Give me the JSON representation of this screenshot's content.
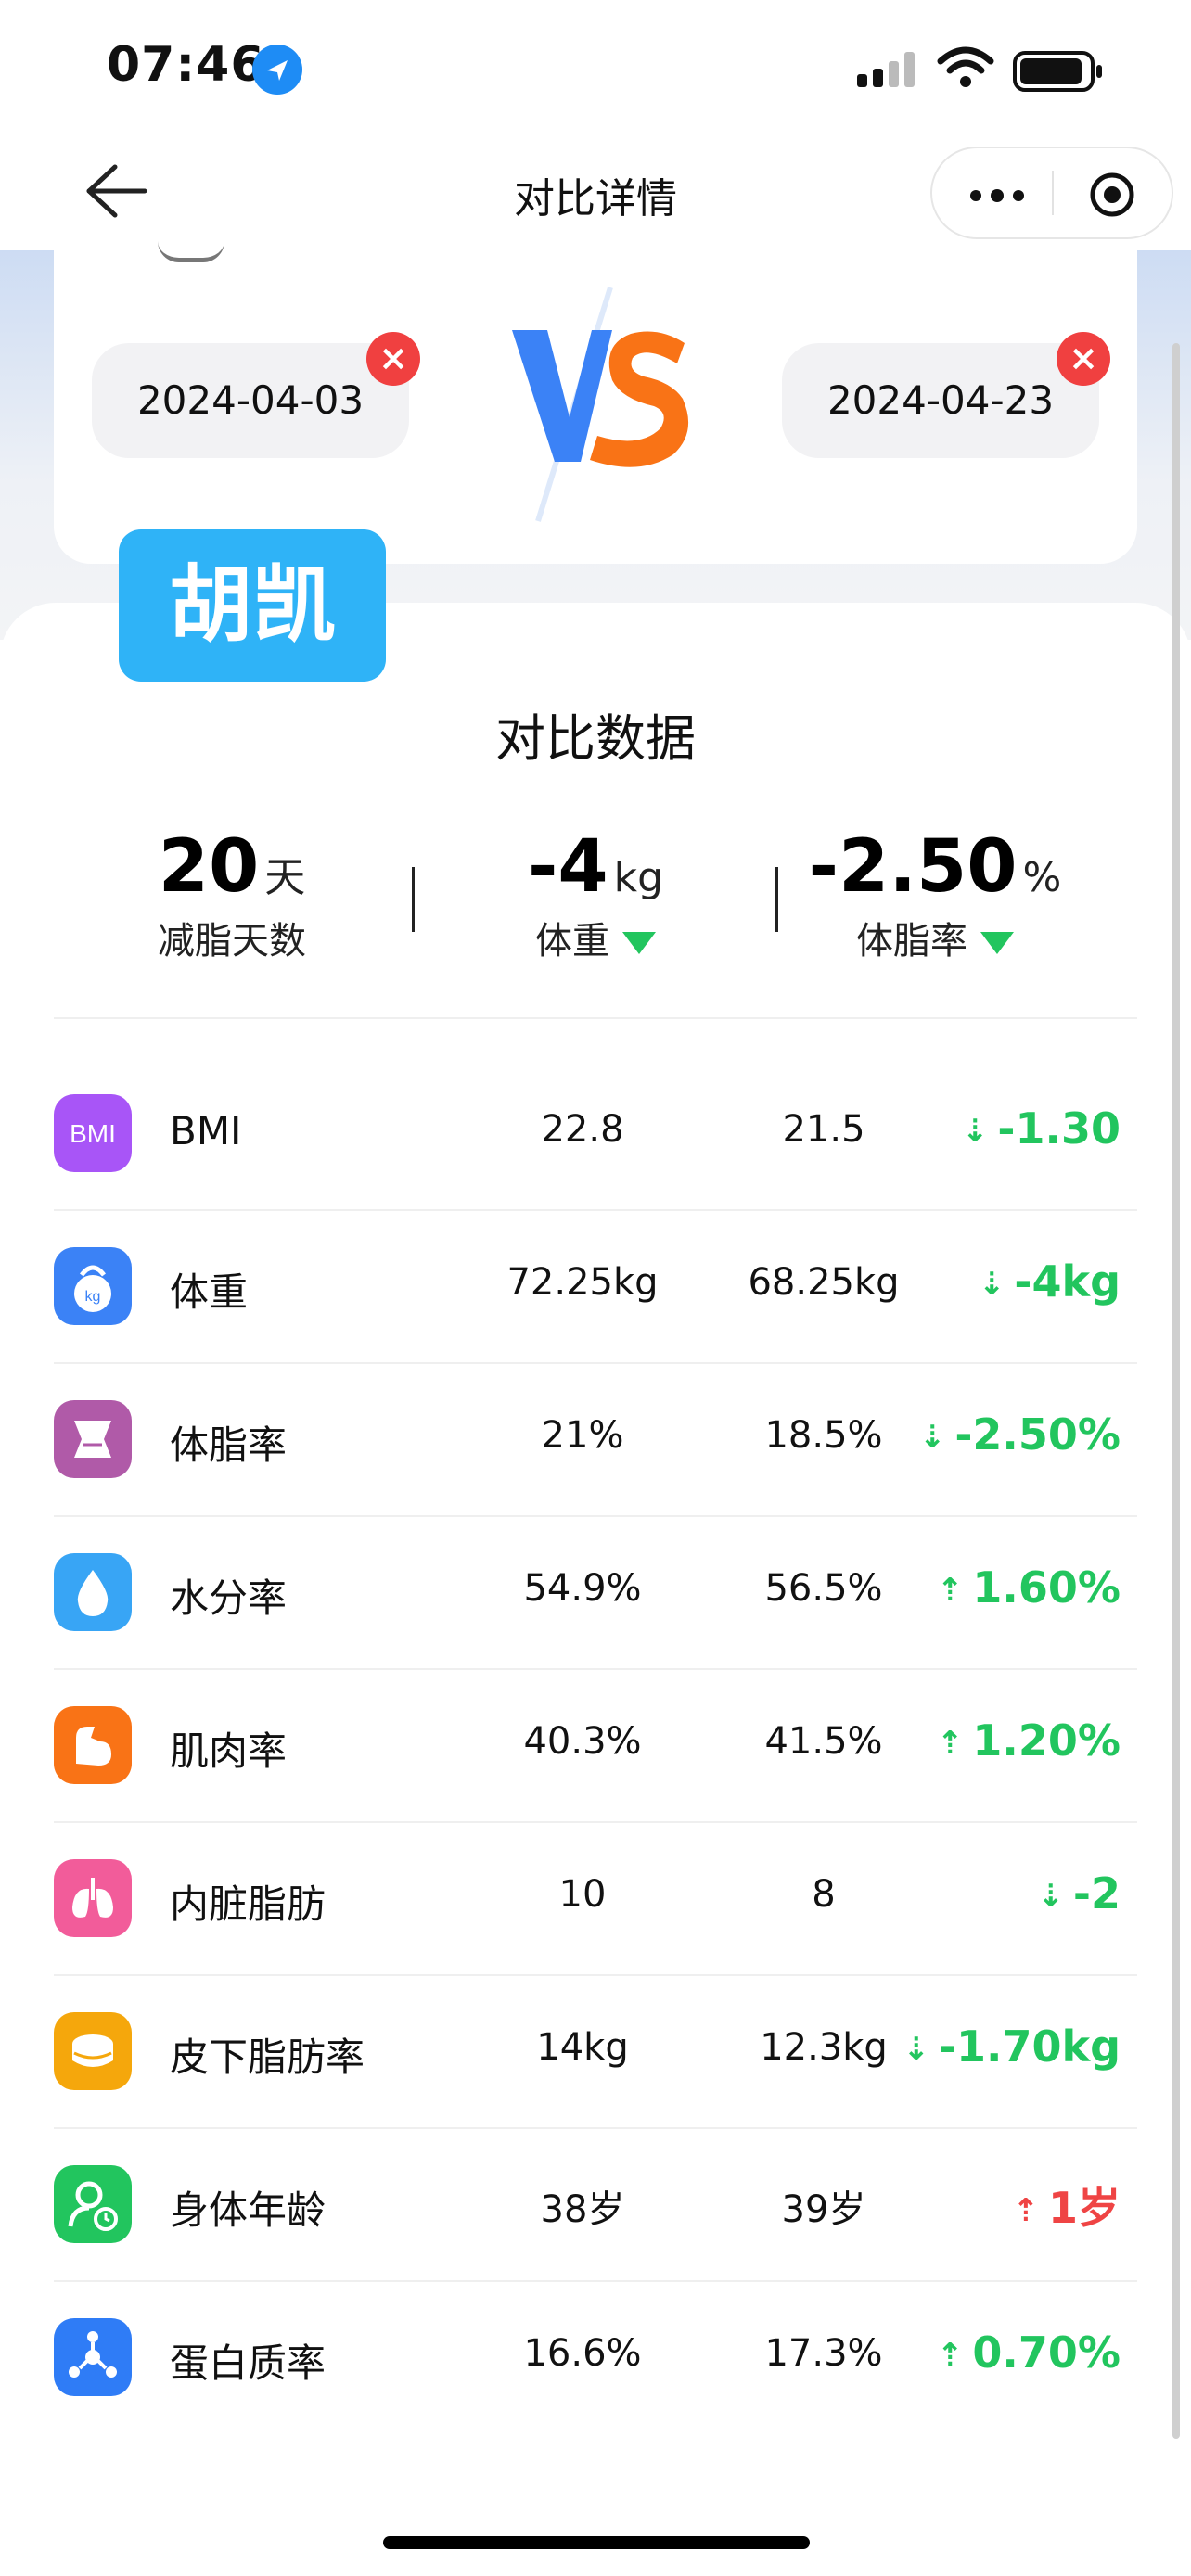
{
  "status_bar": {
    "time": "07:46"
  },
  "nav": {
    "title": "对比详情"
  },
  "compare": {
    "date_left": "2024-04-03",
    "date_right": "2024-04-23",
    "vs": "VS",
    "name": "胡凯"
  },
  "section_title": "对比数据",
  "summary": [
    {
      "value": "20",
      "unit": "天",
      "label": "减脂天数",
      "trend": ""
    },
    {
      "value": "-4",
      "unit": "kg",
      "label": "体重",
      "trend": "down"
    },
    {
      "value": "-2.50",
      "unit": "%",
      "label": "体脂率",
      "trend": "down"
    }
  ],
  "rows": [
    {
      "name": "BMI",
      "v1": "22.8",
      "v2": "21.5",
      "diff": "-1.30",
      "trend": "down",
      "icon": "bmi-icon",
      "color": "#a855f7"
    },
    {
      "name": "体重",
      "v1": "72.25kg",
      "v2": "68.25kg",
      "diff": "-4kg",
      "trend": "down",
      "icon": "kettlebell-icon",
      "color": "#3b82f6"
    },
    {
      "name": "体脂率",
      "v1": "21%",
      "v2": "18.5%",
      "diff": "-2.50%",
      "trend": "down",
      "icon": "body-fat-icon",
      "color": "#b05aa8"
    },
    {
      "name": "水分率",
      "v1": "54.9%",
      "v2": "56.5%",
      "diff": "1.60%",
      "trend": "up",
      "icon": "water-drop-icon",
      "color": "#38a5f5"
    },
    {
      "name": "肌肉率",
      "v1": "40.3%",
      "v2": "41.5%",
      "diff": "1.20%",
      "trend": "up",
      "icon": "muscle-icon",
      "color": "#f97316"
    },
    {
      "name": "内脏脂肪",
      "v1": "10",
      "v2": "8",
      "diff": "-2",
      "trend": "down",
      "icon": "lungs-icon",
      "color": "#f25c9a"
    },
    {
      "name": "皮下脂肪率",
      "v1": "14kg",
      "v2": "12.3kg",
      "diff": "-1.70kg",
      "trend": "down",
      "icon": "fat-layer-icon",
      "color": "#f5a70c"
    },
    {
      "name": "身体年龄",
      "v1": "38岁",
      "v2": "39岁",
      "diff": "1岁",
      "trend": "up-bad",
      "icon": "body-age-icon",
      "color": "#22c55e"
    },
    {
      "name": "蛋白质率",
      "v1": "16.6%",
      "v2": "17.3%",
      "diff": "0.70%",
      "trend": "up",
      "icon": "protein-icon",
      "color": "#2f7cf6"
    }
  ]
}
